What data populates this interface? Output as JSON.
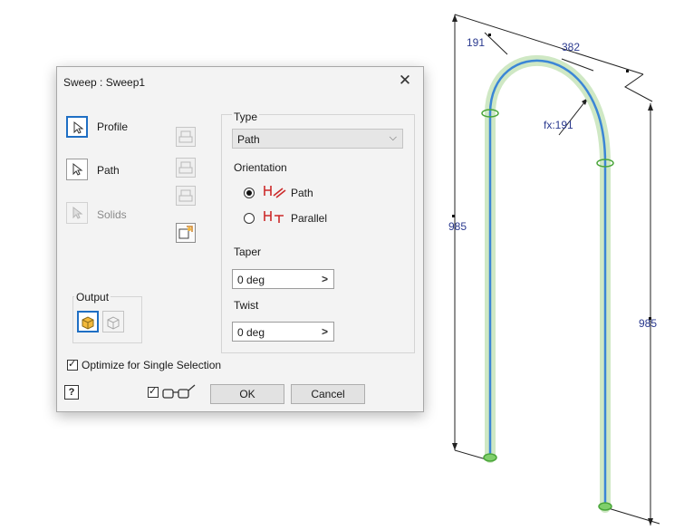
{
  "dialog": {
    "title": "Sweep : Sweep1",
    "close": "✕",
    "selectors": [
      {
        "label": "Profile",
        "state": "active"
      },
      {
        "label": "Path",
        "state": "normal"
      },
      {
        "label": "Solids",
        "state": "disabled"
      }
    ],
    "type": {
      "label": "Type",
      "value": "Path",
      "chevron": "⌵"
    },
    "orientation": {
      "label": "Orientation",
      "options": [
        {
          "label": "Path",
          "selected": true
        },
        {
          "label": "Parallel",
          "selected": false
        }
      ]
    },
    "taper": {
      "label": "Taper",
      "value": "0 deg",
      "arrow": ">"
    },
    "twist": {
      "label": "Twist",
      "value": "0 deg",
      "arrow": ">"
    },
    "output": {
      "label": "Output",
      "selected": "solid"
    },
    "optimize": {
      "label": "Optimize for Single Selection",
      "checked": true
    },
    "preview_checked": true,
    "help": "?",
    "ok": "OK",
    "cancel": "Cancel",
    "check": "✓"
  },
  "viewport": {
    "dimensions": {
      "top_left": "191",
      "top_right": "382",
      "radius": "fx:191",
      "left_height": "985",
      "right_height": "985"
    },
    "colors": {
      "path": "#3b86d6",
      "glow": "#cfe8c4",
      "dimension": "#2b3a8f"
    }
  }
}
